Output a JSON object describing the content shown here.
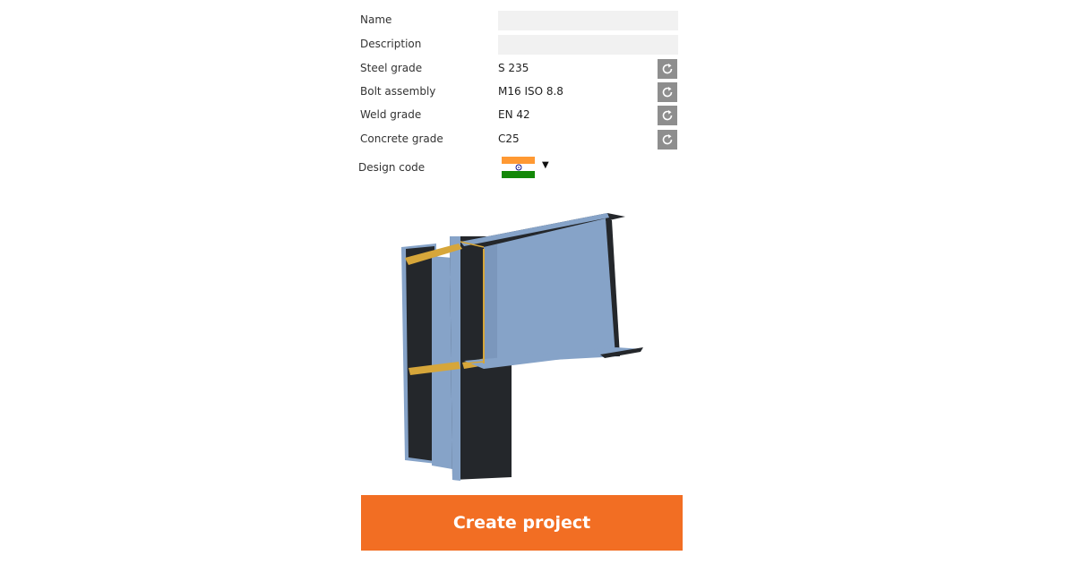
{
  "form": {
    "name": {
      "label": "Name",
      "value": ""
    },
    "description": {
      "label": "Description",
      "value": ""
    },
    "steel_grade": {
      "label": "Steel grade",
      "value": "S 235"
    },
    "bolt_assembly": {
      "label": "Bolt assembly",
      "value": "M16 ISO 8.8"
    },
    "weld_grade": {
      "label": "Weld grade",
      "value": "EN 42"
    },
    "concrete_grade": {
      "label": "Concrete grade",
      "value": "C25"
    },
    "design_code": {
      "label": "Design code",
      "selected_flag": "india-flag",
      "flag_colors": {
        "top": "#ff9933",
        "middle": "#ffffff",
        "bottom": "#138808",
        "chakra": "#000080"
      }
    }
  },
  "reset_icon": "refresh-icon",
  "create_button": {
    "label": "Create project",
    "color": "#f26e23"
  },
  "model_colors": {
    "steel_light": "#86a3c8",
    "steel_dark": "#24272b",
    "weld": "#d6a63a"
  }
}
